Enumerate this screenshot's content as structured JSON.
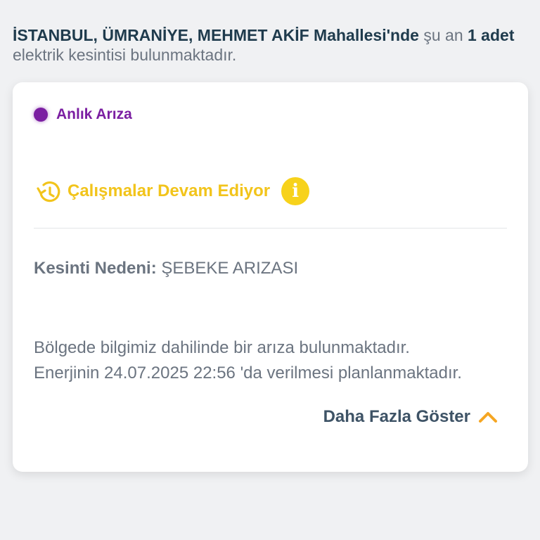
{
  "headline": {
    "location": "İSTANBUL, ÜMRANİYE, MEHMET AKİF Mahallesi'nde",
    "prefix_after_location": " şu an ",
    "count": "1 adet",
    "suffix": " elektrik kesintisi bulunmaktadır."
  },
  "card": {
    "status_label": "Anlık Arıza",
    "status_color": "#7b1fa2",
    "work_label": "Çalışmalar Devam Ediyor",
    "work_color": "#f2c41b",
    "info_icon_glyph": "i",
    "reason_key": "Kesinti Nedeni:",
    "reason_value": "ŞEBEKE ARIZASI",
    "description_line1": "Bölgede bilgimiz dahilinde bir arıza bulunmaktadır.",
    "description_line2": "Enerjinin 24.07.2025 22:56 'da verilmesi planlanmaktadır.",
    "more_label": "Daha Fazla Göster",
    "accent_color": "#f5a623"
  },
  "icons": {
    "status": "status-dot-icon",
    "work": "clock-refresh-icon",
    "info": "info-icon",
    "more": "chevron-up-icon"
  }
}
